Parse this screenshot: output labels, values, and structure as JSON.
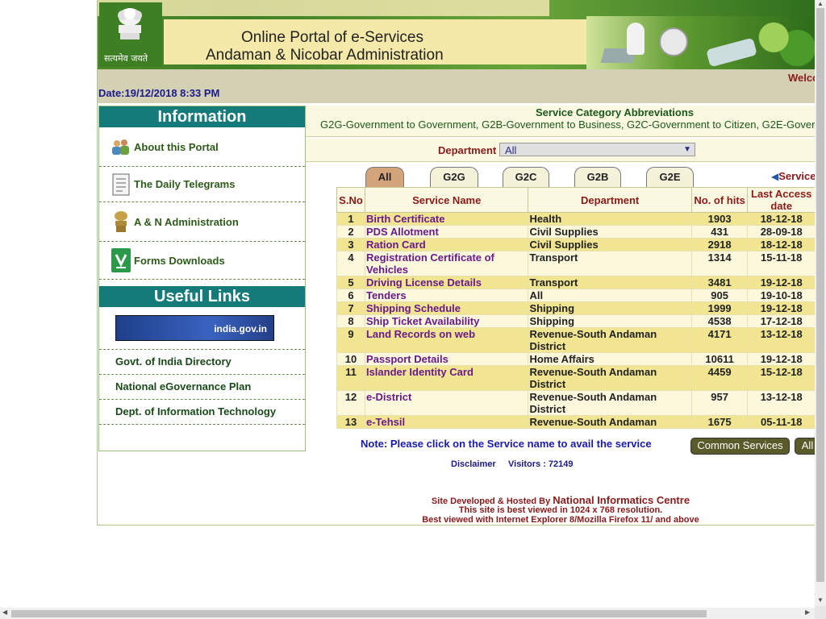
{
  "banner": {
    "emblem_text": "सत्यमेव जयते",
    "title_line1": "Online Portal of e-Services",
    "title_line2": "Andaman & Nicobar Administration"
  },
  "infobar": {
    "welcome": "Welco",
    "date": "Date:19/12/2018 8:33 PM"
  },
  "sidebar": {
    "information_title": "Information",
    "items": [
      {
        "label": "About this Portal",
        "icon": "people-icon"
      },
      {
        "label": "The Daily Telegrams",
        "icon": "document-icon"
      },
      {
        "label": "A & N Administration",
        "icon": "emblem-icon"
      },
      {
        "label": "Forms Downloads",
        "icon": "download-icon"
      }
    ],
    "useful_links_title": "Useful Links",
    "india_gov_banner": "india.gov.in",
    "links": [
      "Govt. of India Directory",
      "National eGovernance Plan",
      "Dept. of Information Technology"
    ]
  },
  "abbreviations": {
    "title": "Service Category Abbreviations",
    "text": "G2G-Government to Government, G2B-Government to Business, G2C-Government to Citizen, G2E-Gover"
  },
  "department": {
    "label": "Department",
    "selected": "All"
  },
  "tabs": [
    "All",
    "G2G",
    "G2C",
    "G2B",
    "G2E"
  ],
  "service_link": "Service",
  "table": {
    "headers": [
      "S.No",
      "Service Name",
      "Department",
      "No. of hits",
      "Last Access date"
    ],
    "rows": [
      {
        "sno": "1",
        "name": "Birth Certificate",
        "dept": "Health",
        "hits": "1903",
        "date": "18-12-18"
      },
      {
        "sno": "2",
        "name": "PDS Allotment",
        "dept": "Civil Supplies",
        "hits": "431",
        "date": "28-09-18"
      },
      {
        "sno": "3",
        "name": "Ration Card",
        "dept": "Civil Supplies",
        "hits": "2918",
        "date": "18-12-18"
      },
      {
        "sno": "4",
        "name": "Registration Certificate of Vehicles",
        "dept": "Transport",
        "hits": "1314",
        "date": "15-11-18"
      },
      {
        "sno": "5",
        "name": "Driving License Details",
        "dept": "Transport",
        "hits": "3481",
        "date": "19-12-18"
      },
      {
        "sno": "6",
        "name": "Tenders",
        "dept": "All",
        "hits": "905",
        "date": "19-10-18"
      },
      {
        "sno": "7",
        "name": "Shipping Schedule",
        "dept": "Shipping",
        "hits": "1999",
        "date": "19-12-18"
      },
      {
        "sno": "8",
        "name": "Ship Ticket Availability",
        "dept": "Shipping",
        "hits": "4538",
        "date": "17-12-18"
      },
      {
        "sno": "9",
        "name": "Land Records on web",
        "dept": "Revenue-South Andaman District",
        "hits": "4171",
        "date": "13-12-18"
      },
      {
        "sno": "10",
        "name": "Passport Details",
        "dept": "Home Affairs",
        "hits": "10611",
        "date": "19-12-18"
      },
      {
        "sno": "11",
        "name": "Islander Identity Card",
        "dept": "Revenue-South Andaman District",
        "hits": "4459",
        "date": "15-12-18"
      },
      {
        "sno": "12",
        "name": "e-District",
        "dept": "Revenue-South Andaman District",
        "hits": "957",
        "date": "13-12-18"
      },
      {
        "sno": "13",
        "name": "e-Tehsil",
        "dept": "Revenue-South Andaman",
        "hits": "1675",
        "date": "05-11-18"
      }
    ]
  },
  "note": "Note: Please click on the Service name to avail the service",
  "buttons": {
    "common_services": "Common Services",
    "all": "All"
  },
  "footer": {
    "disclaimer": "Disclaimer",
    "visitors": "Visitors : 72149",
    "developed_prefix": "Site Developed & Hosted By ",
    "nic": "National Informatics Centre",
    "resolution": "This site is best viewed in 1024 x 768 resolution.",
    "browsers": "Best viewed with Internet Explorer 8/Mozilla Firefox 11/ and above"
  }
}
